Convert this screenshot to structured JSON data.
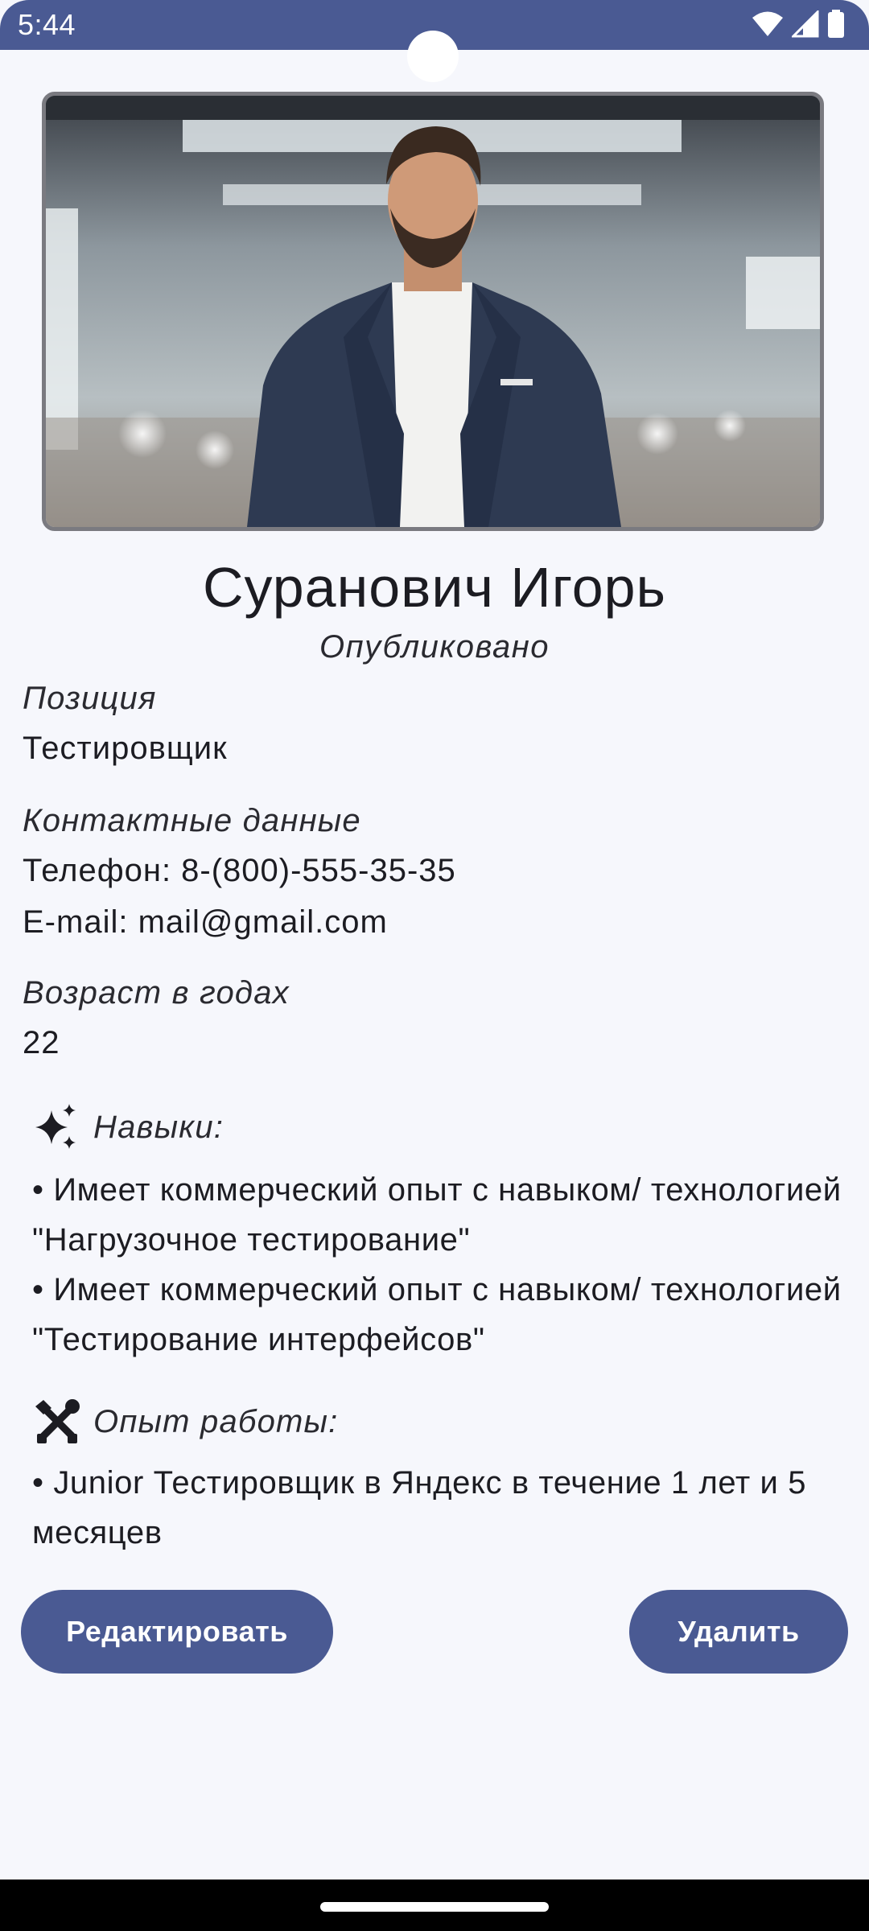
{
  "status_bar": {
    "time": "5:44",
    "icons": [
      "wifi-icon",
      "signal-icon",
      "battery-icon"
    ]
  },
  "profile": {
    "photo_alt": "profile-photo",
    "name": "Суранович Игорь",
    "publication_status": "Опубликовано"
  },
  "position": {
    "label": "Позиция",
    "value": "Тестировщик"
  },
  "contacts": {
    "label": "Контактные данные",
    "phone": "Телефон: 8-(800)-555-35-35",
    "email": "E-mail: mail@gmail.com"
  },
  "age": {
    "label": "Возраст в годах",
    "value": "22"
  },
  "skills": {
    "title": "Навыки:",
    "icon": "sparkles-icon",
    "items": [
      "• Имеет коммерческий опыт с навыком/ технологией \"Нагрузочное тестирование\"",
      "• Имеет коммерческий опыт с навыком/ технологией \"Тестирование интерфейсов\""
    ]
  },
  "experience": {
    "title": "Опыт работы:",
    "icon": "tools-icon",
    "items": [
      "• Junior Тестировщик в Яндекс в течение 1 лет и 5 месяцев"
    ]
  },
  "actions": {
    "edit_label": "Редактировать",
    "delete_label": "Удалить"
  },
  "colors": {
    "accent": "#4a5a93",
    "background": "#f6f7fc",
    "text": "#1c1c22"
  }
}
